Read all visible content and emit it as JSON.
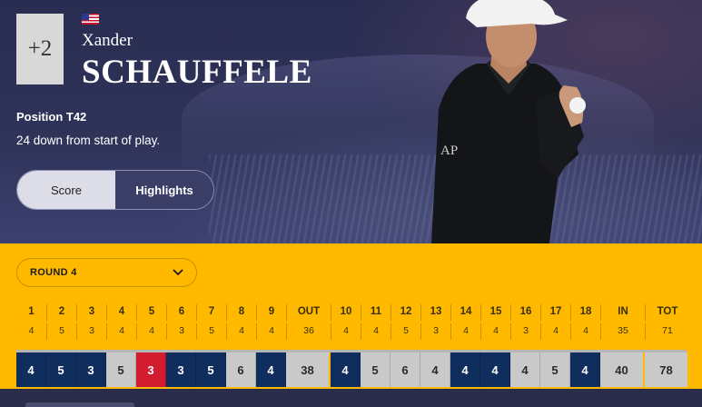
{
  "player": {
    "score_to_par": "+2",
    "first_name": "Xander",
    "last_name": "SCHAUFFELE",
    "position_text": "Position T42",
    "status_text": "24 down from start of play.",
    "country_flag": "us-flag-icon"
  },
  "toggle": {
    "options": [
      "Score",
      "Highlights"
    ],
    "selected": "Score"
  },
  "round_selector": {
    "label": "ROUND 4",
    "icon": "chevron-down-icon"
  },
  "scorecard": {
    "holes": [
      "1",
      "2",
      "3",
      "4",
      "5",
      "6",
      "7",
      "8",
      "9",
      "OUT",
      "10",
      "11",
      "12",
      "13",
      "14",
      "15",
      "16",
      "17",
      "18",
      "IN",
      "TOT"
    ],
    "pars": [
      "4",
      "5",
      "3",
      "4",
      "4",
      "3",
      "5",
      "4",
      "4",
      "36",
      "4",
      "4",
      "5",
      "3",
      "4",
      "4",
      "3",
      "4",
      "4",
      "35",
      "71"
    ],
    "scores": [
      "4",
      "5",
      "3",
      "5",
      "3",
      "3",
      "5",
      "6",
      "4",
      "38",
      "4",
      "5",
      "6",
      "4",
      "4",
      "4",
      "4",
      "5",
      "4",
      "40",
      "78"
    ],
    "score_types": [
      "birdie",
      "birdie",
      "birdie",
      "par",
      "bogey",
      "birdie",
      "birdie",
      "par",
      "birdie",
      "total",
      "birdie",
      "par",
      "par",
      "par",
      "birdie",
      "birdie",
      "par",
      "par",
      "birdie",
      "total",
      "total"
    ]
  },
  "colors": {
    "hero_bg": "#2f3358",
    "scorecard_bg": "#ffba00",
    "dark_cell": "#0f2e5e",
    "grey_cell": "#c9c9c9",
    "red_cell": "#d11c2f"
  }
}
